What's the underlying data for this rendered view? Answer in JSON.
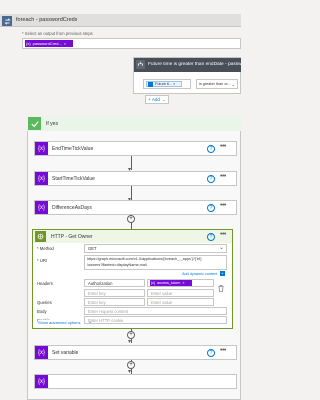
{
  "foreach": {
    "title": "foreach - passwordCreds",
    "select_label": "* Select an output from previous steps",
    "token": "passwordCred...",
    "color": "#486991"
  },
  "condition": {
    "title": "Future time is greater than endDate - passw...",
    "token": "Future ti...",
    "operator": "is greater than or...",
    "add_label": "Add",
    "color": "#484f58"
  },
  "ifyes": {
    "title": "If yes",
    "color": "#5cb85c"
  },
  "actions": [
    {
      "title": "EndTimeTickValue"
    },
    {
      "title": "StartTimeTickValue"
    },
    {
      "title": "DifferenceAsDays"
    }
  ],
  "http": {
    "title": "HTTP - Get Owner",
    "color": "#709727",
    "method_label": "* Method",
    "method_value": "GET",
    "uri_label": "* URI",
    "uri_line1": "https://graph.microsoft.com/v1.0/applications/{foreach_-_apps'}?['id']",
    "uri_line2": "/owners?$select=displayName,mail",
    "add_dynamic": "Add dynamic content",
    "headers_label": "Headers",
    "header_key": "Authorization",
    "header_token": "access_token",
    "enter_key": "Enter key",
    "enter_value": "Enter value",
    "queries_label": "Queries",
    "body_label": "Body",
    "body_placeholder": "Enter request content",
    "cookie_label": "Cookie",
    "cookie_placeholder": "Enter HTTP cookie",
    "show_advanced": "Show advanced options"
  },
  "setvar": {
    "title": "Set variable",
    "color": "#770bd6"
  },
  "accent": "#0078d4",
  "variable_color": "#770bd6"
}
